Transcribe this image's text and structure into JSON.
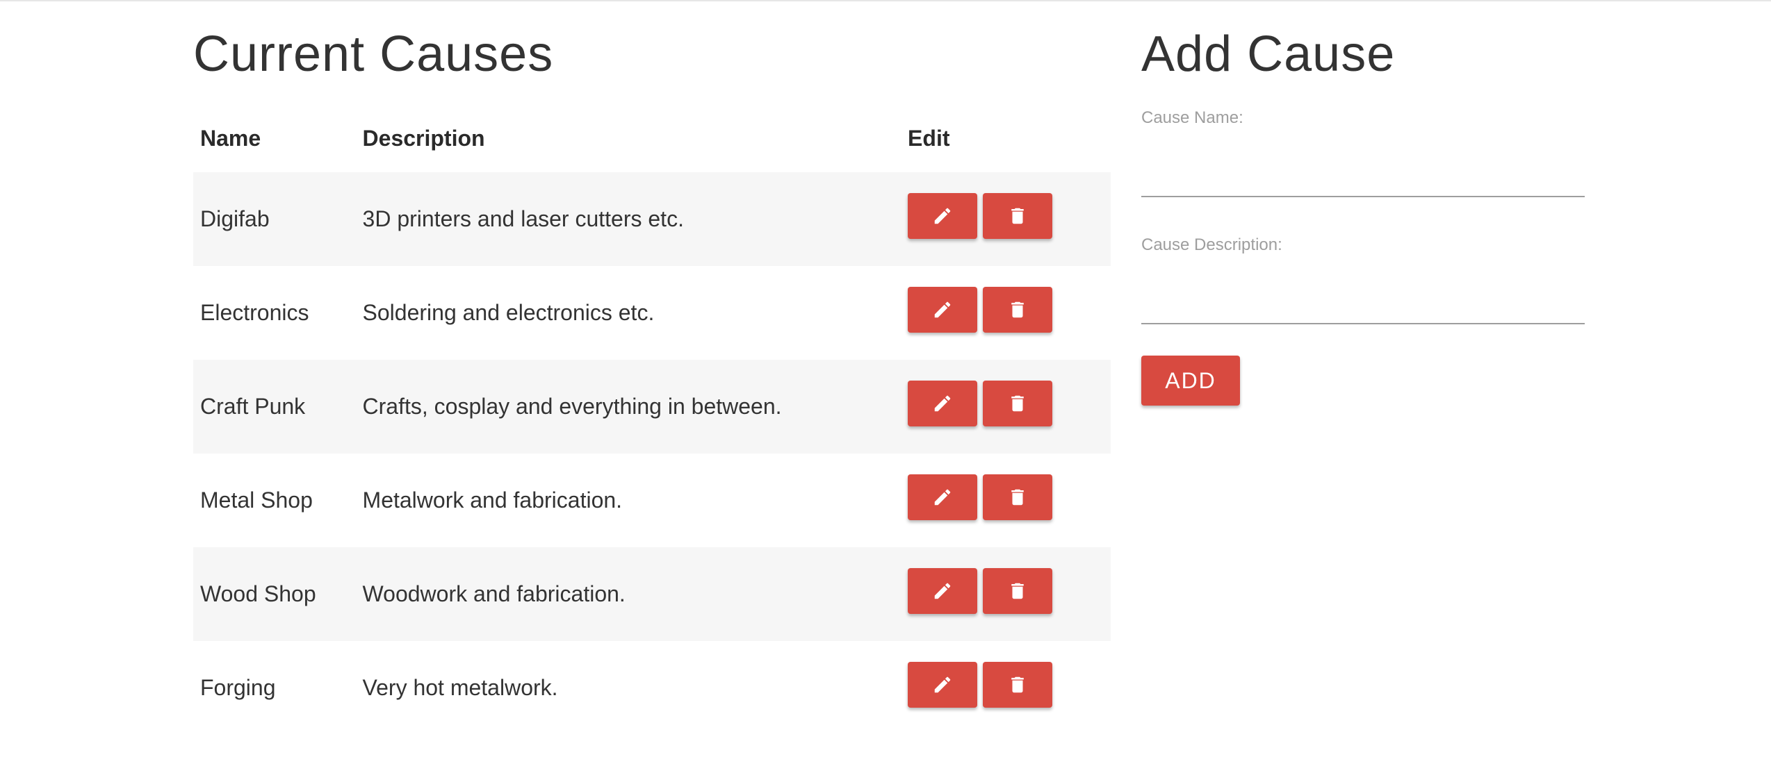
{
  "causes_panel": {
    "title": "Current Causes",
    "columns": {
      "name": "Name",
      "description": "Description",
      "edit": "Edit"
    },
    "rows": [
      {
        "name": "Digifab",
        "description": "3D printers and laser cutters etc."
      },
      {
        "name": "Electronics",
        "description": "Soldering and electronics etc."
      },
      {
        "name": "Craft Punk",
        "description": "Crafts, cosplay and everything in between."
      },
      {
        "name": "Metal Shop",
        "description": "Metalwork and fabrication."
      },
      {
        "name": "Wood Shop",
        "description": "Woodwork and fabrication."
      },
      {
        "name": "Forging",
        "description": "Very hot metalwork."
      }
    ],
    "row_icons": {
      "edit": "pencil-icon",
      "delete": "trash-icon"
    }
  },
  "add_cause": {
    "title": "Add Cause",
    "name_label": "Cause Name:",
    "name_value": "",
    "description_label": "Cause Description:",
    "description_value": "",
    "add_button_label": "ADD"
  },
  "colors": {
    "accent": "#d84a40",
    "text": "#333333",
    "muted_label": "#9e9e9e",
    "striped_row": "#f6f6f6"
  }
}
